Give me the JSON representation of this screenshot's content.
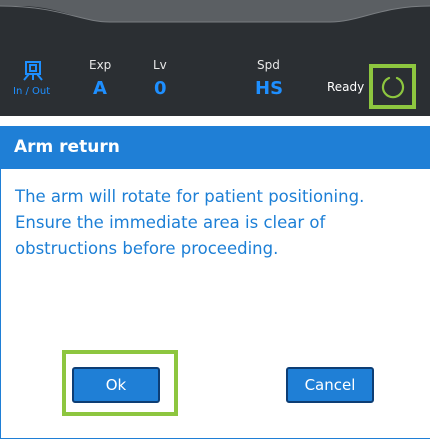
{
  "statusbar": {
    "inout_label": "In / Out",
    "exp": {
      "label": "Exp",
      "value": "A"
    },
    "lv": {
      "label": "Lv",
      "value": "0"
    },
    "spd": {
      "label": "Spd",
      "value": "HS"
    },
    "ready_label": "Ready",
    "ready_icon": "spinner-icon",
    "accent_color": "#1e8fff",
    "highlight_color": "#8dc63f"
  },
  "dialog": {
    "title": "Arm return",
    "message_lines": [
      "The arm will rotate for patient positioning.",
      "Ensure the immediate area is clear of",
      "obstructions before proceeding."
    ],
    "ok_label": "Ok",
    "cancel_label": "Cancel",
    "header_color": "#1f7fd6"
  }
}
